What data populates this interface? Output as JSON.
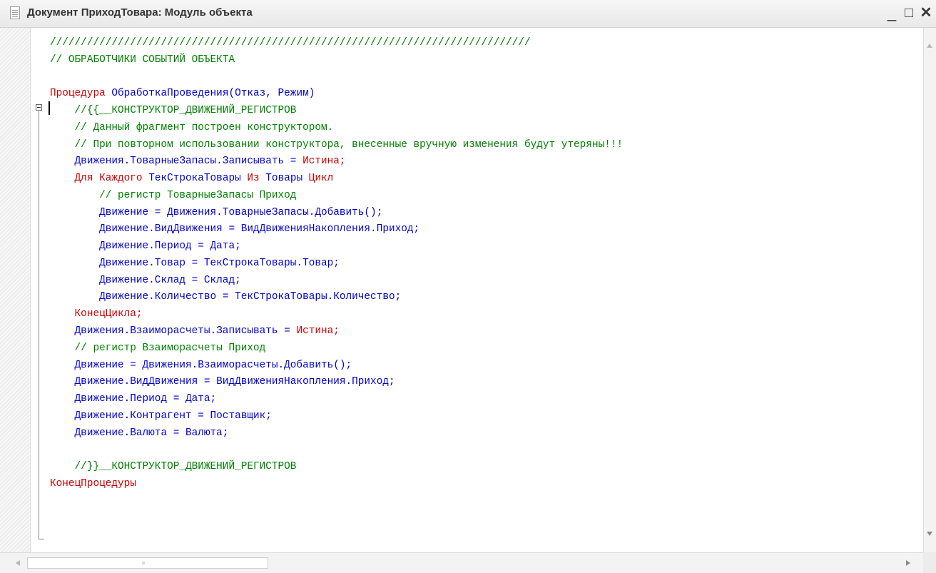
{
  "window": {
    "title": "Документ ПриходТовара: Модуль объекта",
    "minimize_glyph": "_",
    "maximize_glyph": "□",
    "close_glyph": "✕"
  },
  "icons": {
    "document": "document-icon",
    "fold_toggle": "minus-box-icon"
  },
  "colors": {
    "keyword": "#cc0000",
    "identifier": "#0000cc",
    "comment": "#008000"
  },
  "code": {
    "lines": [
      {
        "segments": [
          {
            "text": "//////////////////////////////////////////////////////////////////////////////",
            "kind": "comment"
          }
        ]
      },
      {
        "segments": [
          {
            "text": "// ОБРАБОТЧИКИ СОБЫТИЙ ОБЪЕКТА",
            "kind": "comment"
          }
        ]
      },
      {
        "segments": []
      },
      {
        "segments": [
          {
            "text": "Процедура",
            "kind": "keyword"
          },
          {
            "text": " ОбработкаПроведения(Отказ, Режим)",
            "kind": "identifier"
          }
        ]
      },
      {
        "segments": [
          {
            "text": "    //{{__КОНСТРУКТОР_ДВИЖЕНИЙ_РЕГИСТРОВ",
            "kind": "comment"
          }
        ]
      },
      {
        "segments": [
          {
            "text": "    // Данный фрагмент построен конструктором.",
            "kind": "comment"
          }
        ]
      },
      {
        "segments": [
          {
            "text": "    // При повторном использовании конструктора, внесенные вручную изменения будут утеряны!!!",
            "kind": "comment"
          }
        ]
      },
      {
        "segments": [
          {
            "text": "    Движения.ТоварныеЗапасы.Записывать = ",
            "kind": "identifier"
          },
          {
            "text": "Истина;",
            "kind": "keyword"
          }
        ]
      },
      {
        "segments": [
          {
            "text": "    Для Каждого ",
            "kind": "keyword"
          },
          {
            "text": "ТекСтрокаТовары ",
            "kind": "identifier"
          },
          {
            "text": "Из ",
            "kind": "keyword"
          },
          {
            "text": "Товары ",
            "kind": "identifier"
          },
          {
            "text": "Цикл",
            "kind": "keyword"
          }
        ]
      },
      {
        "segments": [
          {
            "text": "        // регистр ТоварныеЗапасы Приход",
            "kind": "comment"
          }
        ]
      },
      {
        "segments": [
          {
            "text": "        Движение = Движения.ТоварныеЗапасы.Добавить();",
            "kind": "identifier"
          }
        ]
      },
      {
        "segments": [
          {
            "text": "        Движение.ВидДвижения = ВидДвиженияНакопления.Приход;",
            "kind": "identifier"
          }
        ]
      },
      {
        "segments": [
          {
            "text": "        Движение.Период = Дата;",
            "kind": "identifier"
          }
        ]
      },
      {
        "segments": [
          {
            "text": "        Движение.Товар = ТекСтрокаТовары.Товар;",
            "kind": "identifier"
          }
        ]
      },
      {
        "segments": [
          {
            "text": "        Движение.Склад = Склад;",
            "kind": "identifier"
          }
        ]
      },
      {
        "segments": [
          {
            "text": "        Движение.Количество = ТекСтрокаТовары.Количество;",
            "kind": "identifier"
          }
        ]
      },
      {
        "segments": [
          {
            "text": "    КонецЦикла;",
            "kind": "keyword"
          }
        ]
      },
      {
        "segments": [
          {
            "text": "    Движения.Взаиморасчеты.Записывать = ",
            "kind": "identifier"
          },
          {
            "text": "Истина;",
            "kind": "keyword"
          }
        ]
      },
      {
        "segments": [
          {
            "text": "    // регистр Взаиморасчеты Приход",
            "kind": "comment"
          }
        ]
      },
      {
        "segments": [
          {
            "text": "    Движение = Движения.Взаиморасчеты.Добавить();",
            "kind": "identifier"
          }
        ]
      },
      {
        "segments": [
          {
            "text": "    Движение.ВидДвижения = ВидДвиженияНакопления.Приход;",
            "kind": "identifier"
          }
        ]
      },
      {
        "segments": [
          {
            "text": "    Движение.Период = Дата;",
            "kind": "identifier"
          }
        ]
      },
      {
        "segments": [
          {
            "text": "    Движение.Контрагент = Поставщик;",
            "kind": "identifier"
          }
        ]
      },
      {
        "segments": [
          {
            "text": "    Движение.Валюта = Валюта;",
            "kind": "identifier"
          }
        ]
      },
      {
        "segments": []
      },
      {
        "segments": [
          {
            "text": "    //}}__КОНСТРУКТОР_ДВИЖЕНИЙ_РЕГИСТРОВ",
            "kind": "comment"
          }
        ]
      },
      {
        "segments": [
          {
            "text": "КонецПроцедуры",
            "kind": "keyword"
          }
        ]
      }
    ]
  }
}
